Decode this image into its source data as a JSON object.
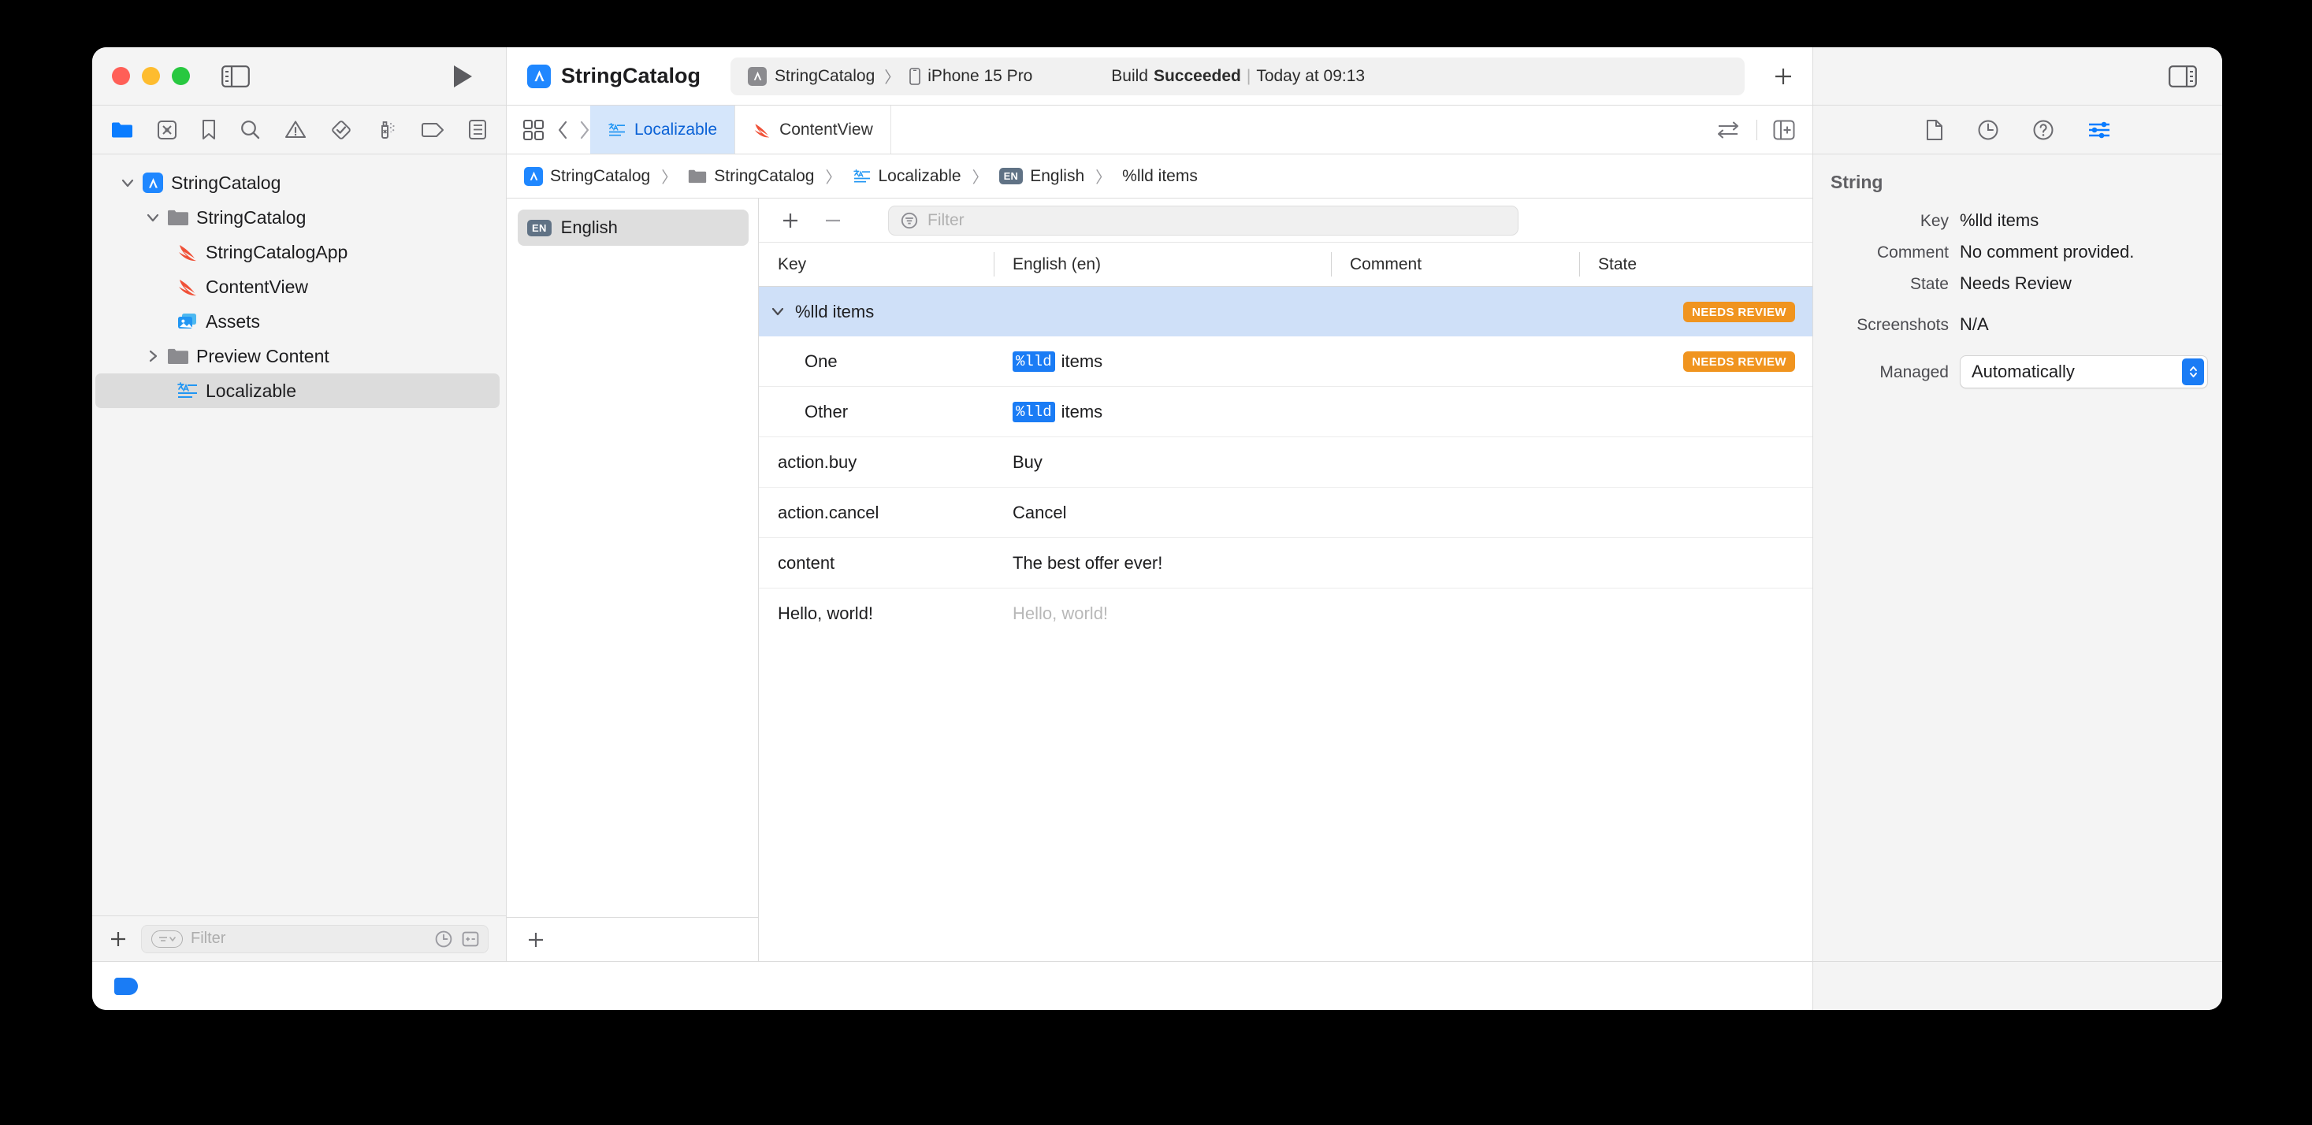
{
  "window": {
    "traffic_lights": [
      "close",
      "minimize",
      "zoom"
    ]
  },
  "toolbar": {
    "scheme_title": "StringCatalog",
    "scheme_name": "StringCatalog",
    "destination": "iPhone 15 Pro",
    "build_prefix": "Build",
    "build_result": "Succeeded",
    "build_separator": "|",
    "build_time": "Today at 09:13",
    "add_label": "+",
    "chevron": "〉"
  },
  "navigator": {
    "tabs": [
      {
        "name": "project-navigator",
        "active": true
      },
      {
        "name": "source-control-navigator",
        "active": false
      },
      {
        "name": "bookmark-navigator",
        "active": false
      },
      {
        "name": "find-navigator",
        "active": false
      },
      {
        "name": "issue-navigator",
        "active": false
      },
      {
        "name": "test-navigator",
        "active": false
      },
      {
        "name": "debug-navigator",
        "active": false
      },
      {
        "name": "breakpoint-navigator",
        "active": false
      },
      {
        "name": "report-navigator",
        "active": false
      }
    ],
    "tree": [
      {
        "label": "StringCatalog",
        "icon": "app-icon",
        "depth": 0,
        "twisty": "down",
        "selected": false
      },
      {
        "label": "StringCatalog",
        "icon": "folder-icon",
        "depth": 1,
        "twisty": "down",
        "selected": false
      },
      {
        "label": "StringCatalogApp",
        "icon": "swift-icon",
        "depth": 2,
        "twisty": "none",
        "selected": false
      },
      {
        "label": "ContentView",
        "icon": "swift-icon",
        "depth": 2,
        "twisty": "none",
        "selected": false
      },
      {
        "label": "Assets",
        "icon": "assets-icon",
        "depth": 2,
        "twisty": "none",
        "selected": false
      },
      {
        "label": "Preview Content",
        "icon": "folder-icon",
        "depth": 1,
        "twisty": "right",
        "selected": false
      },
      {
        "label": "Localizable",
        "icon": "stringcatalog-icon",
        "depth": 2,
        "twisty": "none",
        "selected": true
      }
    ],
    "filter_placeholder": "Filter",
    "add_label": "+"
  },
  "editor": {
    "tabs": [
      {
        "label": "Localizable",
        "icon": "stringcatalog-icon",
        "active": true
      },
      {
        "label": "ContentView",
        "icon": "swift-icon",
        "active": false
      }
    ],
    "breadcrumb": [
      {
        "label": "StringCatalog",
        "icon": "app-icon"
      },
      {
        "label": "StringCatalog",
        "icon": "folder-icon"
      },
      {
        "label": "Localizable",
        "icon": "stringcatalog-icon"
      },
      {
        "label": "English",
        "icon": "en-badge"
      },
      {
        "label": "%lld items",
        "icon": "none"
      }
    ],
    "breadcrumb_separator": "〉"
  },
  "languages": {
    "items": [
      {
        "code": "EN",
        "label": "English",
        "selected": true
      }
    ],
    "add_label": "+"
  },
  "table": {
    "toolbar": {
      "add_label": "+",
      "remove_label": "−",
      "filter_placeholder": "Filter"
    },
    "columns": [
      "Key",
      "English (en)",
      "Comment",
      "State"
    ],
    "rows": [
      {
        "key": "%lld items",
        "value_token": "",
        "value_text": "",
        "comment": "",
        "state": "NEEDS REVIEW",
        "type": "group",
        "selected": true,
        "twisty": "down"
      },
      {
        "key": "One",
        "value_token": "%lld",
        "value_text": "items",
        "comment": "",
        "state": "NEEDS REVIEW",
        "type": "child",
        "selected": false,
        "twisty": "none"
      },
      {
        "key": "Other",
        "value_token": "%lld",
        "value_text": "items",
        "comment": "",
        "state": "",
        "type": "child",
        "selected": false,
        "twisty": "none"
      },
      {
        "key": "action.buy",
        "value_token": "",
        "value_text": "Buy",
        "comment": "",
        "state": "",
        "type": "normal",
        "selected": false,
        "twisty": "none"
      },
      {
        "key": "action.cancel",
        "value_token": "",
        "value_text": "Cancel",
        "comment": "",
        "state": "",
        "type": "normal",
        "selected": false,
        "twisty": "none"
      },
      {
        "key": "content",
        "value_token": "",
        "value_text": "The best offer ever!",
        "comment": "",
        "state": "",
        "type": "normal",
        "selected": false,
        "twisty": "none"
      },
      {
        "key": "Hello, world!",
        "value_token": "",
        "value_text": "Hello, world!",
        "comment": "",
        "state": "",
        "type": "placeholder",
        "selected": false,
        "twisty": "none"
      }
    ]
  },
  "inspector": {
    "tabs": [
      {
        "name": "file-inspector",
        "active": false
      },
      {
        "name": "history-inspector",
        "active": false
      },
      {
        "name": "quick-help-inspector",
        "active": false
      },
      {
        "name": "attributes-inspector",
        "active": true
      }
    ],
    "title": "String",
    "fields": [
      {
        "label": "Key",
        "value": "%lld items"
      },
      {
        "label": "Comment",
        "value": "No comment provided."
      },
      {
        "label": "State",
        "value": "Needs Review"
      },
      {
        "label": "Screenshots",
        "value": "N/A"
      }
    ],
    "managed_label": "Managed",
    "managed_value": "Automatically"
  },
  "colors": {
    "accent_blue": "#1a7cf5",
    "selection_blue": "#cfe0f8",
    "needs_review_orange": "#f0941f",
    "swift_orange": "#f05138",
    "window_chrome": "#f4f4f4"
  }
}
